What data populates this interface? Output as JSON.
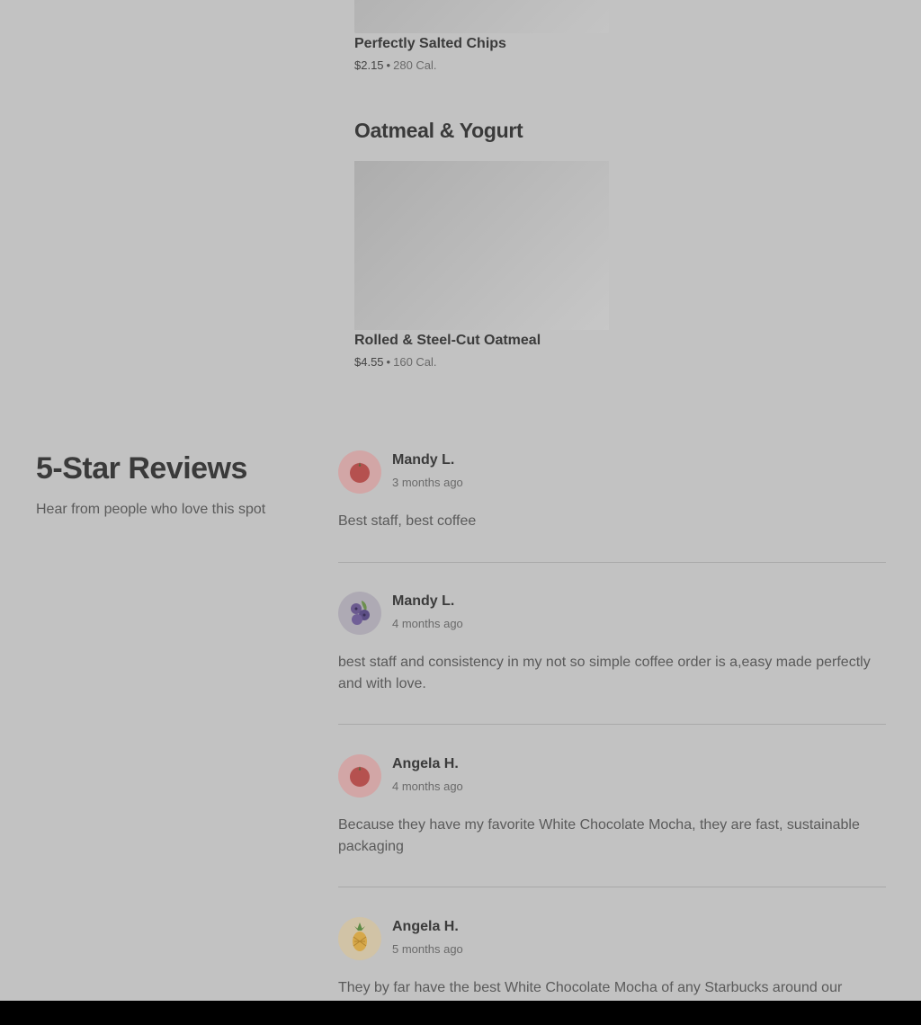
{
  "menu": {
    "items_top": [
      {
        "name": "Perfectly Salted Chips",
        "price": "$2.15",
        "separator": "•",
        "calories": "280 Cal."
      }
    ],
    "category": {
      "title": "Oatmeal & Yogurt",
      "items": [
        {
          "name": "Rolled & Steel-Cut Oatmeal",
          "price": "$4.55",
          "separator": "•",
          "calories": "160 Cal."
        }
      ]
    }
  },
  "reviews": {
    "title": "5-Star Reviews",
    "subtitle": "Hear from people who love this spot",
    "list": [
      {
        "name": "Mandy L.",
        "time": "3 months ago",
        "text": "Best staff, best coffee",
        "avatar": "tomato-icon",
        "avatar_bg": "#d2a6a6"
      },
      {
        "name": "Mandy L.",
        "time": "4 months ago",
        "text": "best staff and consistency in my not so simple coffee order is a,easy made perfectly and with love.",
        "avatar": "blueberry-icon",
        "avatar_bg": "#aeaab4"
      },
      {
        "name": "Angela H.",
        "time": "4 months ago",
        "text": "Because they have my favorite White Chocolate Mocha, they are fast, sustainable packaging",
        "avatar": "tomato-icon",
        "avatar_bg": "#d2a6a6"
      },
      {
        "name": "Angela H.",
        "time": "5 months ago",
        "text": "They by far have the best White Chocolate Mocha of any Starbucks around our",
        "avatar": "pineapple-icon",
        "avatar_bg": "#d1c3a6"
      }
    ]
  }
}
